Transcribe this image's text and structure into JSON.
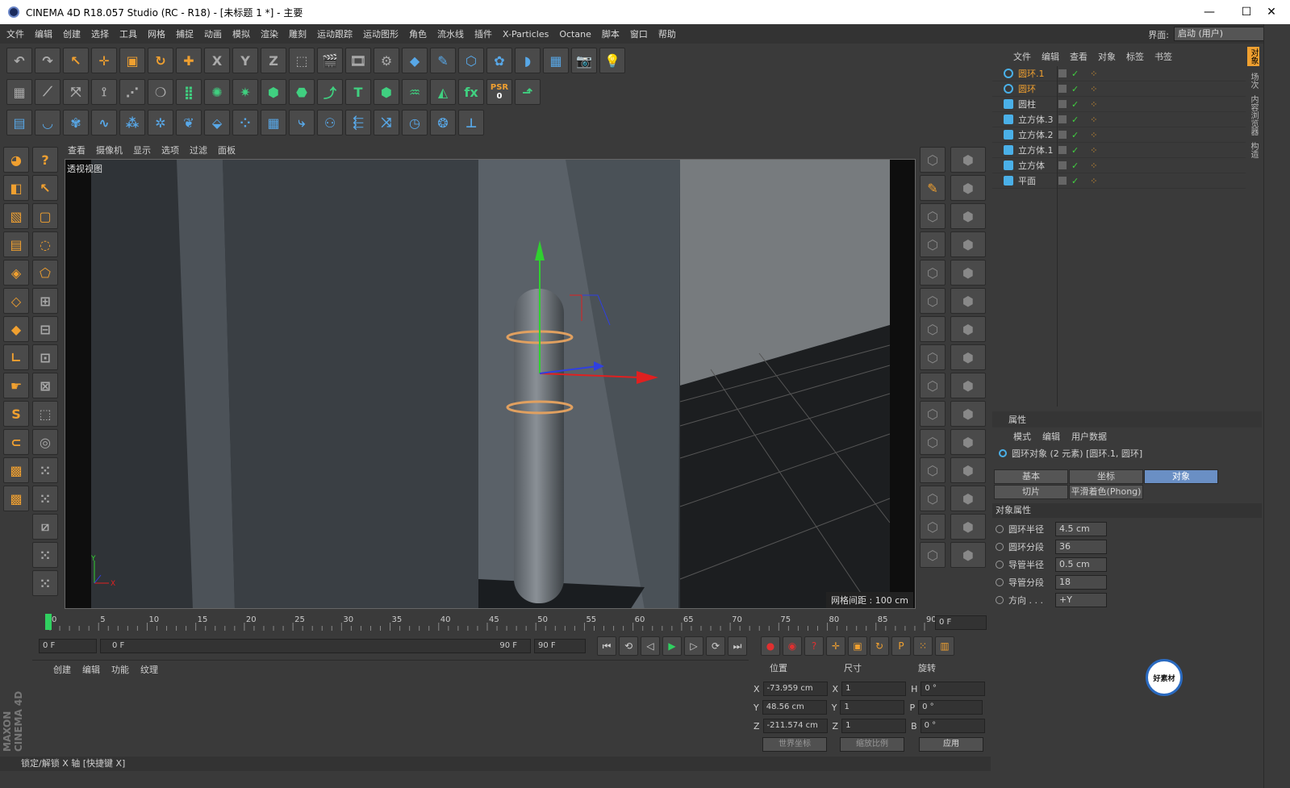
{
  "window": {
    "title": "CINEMA 4D R18.057 Studio (RC - R18) - [未标题 1 *] - 主要",
    "minimize": "—",
    "maximize": "☐",
    "close": "✕"
  },
  "menu": [
    "文件",
    "编辑",
    "创建",
    "选择",
    "工具",
    "网格",
    "捕捉",
    "动画",
    "模拟",
    "渲染",
    "雕刻",
    "运动跟踪",
    "运动图形",
    "角色",
    "流水线",
    "插件",
    "X-Particles",
    "Octane",
    "脚本",
    "窗口",
    "帮助"
  ],
  "layout": {
    "label": "界面:",
    "value": "启动 (用户)"
  },
  "toolbar_row1": [
    {
      "name": "undo-icon",
      "glyph": "↶"
    },
    {
      "name": "redo-icon",
      "glyph": "↷"
    },
    {
      "name": "select-icon",
      "glyph": "↖"
    },
    {
      "name": "move-icon",
      "glyph": "✛"
    },
    {
      "name": "scale-icon",
      "glyph": "▣"
    },
    {
      "name": "rotate-icon",
      "glyph": "↻"
    },
    {
      "name": "add-icon",
      "glyph": "✚"
    },
    {
      "name": "x-axis-icon",
      "glyph": "X"
    },
    {
      "name": "y-axis-icon",
      "glyph": "Y"
    },
    {
      "name": "z-axis-icon",
      "glyph": "Z"
    },
    {
      "name": "coord-system-icon",
      "glyph": "⬚"
    },
    {
      "name": "render-view-icon",
      "glyph": "🎬"
    },
    {
      "name": "render-picture-viewer-icon",
      "glyph": "🎞"
    },
    {
      "name": "render-settings-icon",
      "glyph": "⚙"
    },
    {
      "name": "cube-icon",
      "glyph": "◆"
    },
    {
      "name": "pen-icon",
      "glyph": "✎"
    },
    {
      "name": "subdivision-icon",
      "glyph": "⬡"
    },
    {
      "name": "cloner-icon",
      "glyph": "✿"
    },
    {
      "name": "deformer-icon",
      "glyph": "◗"
    },
    {
      "name": "floor-icon",
      "glyph": "▦"
    },
    {
      "name": "camera-icon",
      "glyph": "📷"
    },
    {
      "name": "light-icon",
      "glyph": "💡"
    }
  ],
  "toolbar_row2": [
    {
      "name": "plugin-icon-1",
      "glyph": "▦"
    },
    {
      "name": "plugin-icon-2",
      "glyph": "⟋"
    },
    {
      "name": "plugin-icon-3",
      "glyph": "⤧"
    },
    {
      "name": "plugin-icon-4",
      "glyph": "⟟"
    },
    {
      "name": "plugin-icon-5",
      "glyph": "⋰"
    },
    {
      "name": "plugin-icon-6",
      "glyph": "❍"
    },
    {
      "name": "plugin-icon-7",
      "glyph": "⣿"
    },
    {
      "name": "plugin-icon-8",
      "glyph": "✺"
    },
    {
      "name": "plugin-icon-9",
      "glyph": "✷"
    },
    {
      "name": "plugin-icon-10",
      "glyph": "⬢"
    },
    {
      "name": "plugin-icon-11",
      "glyph": "⬣"
    },
    {
      "name": "plugin-icon-12",
      "glyph": "⤴"
    },
    {
      "name": "text-icon",
      "glyph": "T"
    },
    {
      "name": "plugin-icon-13",
      "glyph": "⬢"
    },
    {
      "name": "plugin-icon-14",
      "glyph": "♒"
    },
    {
      "name": "plugin-icon-15",
      "glyph": "◭"
    },
    {
      "name": "fx-icon",
      "glyph": "fx"
    },
    {
      "name": "psr-icon",
      "glyph": "PSR"
    },
    {
      "name": "plugin-icon-16",
      "glyph": "⬏"
    }
  ],
  "psr_value": "0",
  "toolbar_row3": [
    {
      "name": "xp-icon-1",
      "glyph": "▤"
    },
    {
      "name": "xp-icon-2",
      "glyph": "◡"
    },
    {
      "name": "xp-icon-3",
      "glyph": "✾"
    },
    {
      "name": "xp-icon-4",
      "glyph": "∿"
    },
    {
      "name": "xp-icon-5",
      "glyph": "⁂"
    },
    {
      "name": "xp-icon-6",
      "glyph": "✲"
    },
    {
      "name": "xp-icon-7",
      "glyph": "❦"
    },
    {
      "name": "xp-icon-8",
      "glyph": "⬙"
    },
    {
      "name": "xp-icon-9",
      "glyph": "⁘"
    },
    {
      "name": "xp-icon-10",
      "glyph": "▦"
    },
    {
      "name": "xp-icon-11",
      "glyph": "⤷"
    },
    {
      "name": "xp-icon-12",
      "glyph": "⚇"
    },
    {
      "name": "xp-icon-13",
      "glyph": "⬱"
    },
    {
      "name": "xp-icon-14",
      "glyph": "⤨"
    },
    {
      "name": "xp-icon-15",
      "glyph": "◷"
    },
    {
      "name": "xp-icon-16",
      "glyph": "❂"
    },
    {
      "name": "xp-icon-17",
      "glyph": "⊥"
    }
  ],
  "left_col": [
    {
      "name": "model-mode-icon",
      "glyph": "◕"
    },
    {
      "name": "object-mode-icon",
      "glyph": "◧"
    },
    {
      "name": "texture-mode-icon",
      "glyph": "▧"
    },
    {
      "name": "workplane-icon",
      "glyph": "▤"
    },
    {
      "name": "point-mode-icon",
      "glyph": "◈"
    },
    {
      "name": "edge-mode-icon",
      "glyph": "◇"
    },
    {
      "name": "polygon-mode-icon",
      "glyph": "◆"
    },
    {
      "name": "axis-mode-icon",
      "glyph": "∟"
    },
    {
      "name": "tweak-mode-icon",
      "glyph": "☛"
    },
    {
      "name": "solo-icon",
      "glyph": "S"
    },
    {
      "name": "snap-icon",
      "glyph": "⊂"
    },
    {
      "name": "snap-settings-icon",
      "glyph": "▩"
    },
    {
      "name": "workplane-snap-icon",
      "glyph": "▩"
    }
  ],
  "left_col2": [
    {
      "name": "help-icon",
      "glyph": "?"
    },
    {
      "name": "live-select-icon",
      "glyph": "↖"
    },
    {
      "name": "rect-select-icon",
      "glyph": "▢"
    },
    {
      "name": "lasso-select-icon",
      "glyph": "◌"
    },
    {
      "name": "poly-select-icon",
      "glyph": "⬠"
    },
    {
      "name": "tool-icon-1",
      "glyph": "⊞"
    },
    {
      "name": "tool-icon-2",
      "glyph": "⊟"
    },
    {
      "name": "tool-icon-3",
      "glyph": "⊡"
    },
    {
      "name": "tool-icon-4",
      "glyph": "⊠"
    },
    {
      "name": "tool-icon-5",
      "glyph": "⬚"
    },
    {
      "name": "tool-icon-6",
      "glyph": "◎"
    },
    {
      "name": "tool-icon-7",
      "glyph": "⁙"
    },
    {
      "name": "tool-icon-8",
      "glyph": "⁙"
    },
    {
      "name": "tool-icon-9",
      "glyph": "⧄"
    },
    {
      "name": "tool-icon-10",
      "glyph": "⁙"
    },
    {
      "name": "tool-icon-11",
      "glyph": "⁙"
    }
  ],
  "viewport": {
    "menu": [
      "查看",
      "摄像机",
      "显示",
      "选项",
      "过滤",
      "面板"
    ],
    "label": "透视视图",
    "grid_info": "网格间距 : 100 cm",
    "axis_y": "Y",
    "axis_x": "X"
  },
  "timeline": {
    "ticks": [
      "0",
      "5",
      "10",
      "15",
      "20",
      "25",
      "30",
      "35",
      "40",
      "45",
      "50",
      "55",
      "60",
      "65",
      "70",
      "75",
      "80",
      "85",
      "90"
    ],
    "current_frame": "0 F"
  },
  "playback": {
    "start": "0 F",
    "range_start": "0 F",
    "range_end": "90 F",
    "end": "90 F",
    "icons": [
      {
        "name": "goto-start-icon",
        "glyph": "⏮"
      },
      {
        "name": "prev-key-icon",
        "glyph": "⟲"
      },
      {
        "name": "prev-frame-icon",
        "glyph": "◁"
      },
      {
        "name": "play-icon",
        "glyph": "▶"
      },
      {
        "name": "next-frame-icon",
        "glyph": "▷"
      },
      {
        "name": "next-key-icon",
        "glyph": "⟳"
      },
      {
        "name": "goto-end-icon",
        "glyph": "⏭"
      }
    ],
    "rec_icons": [
      {
        "name": "record-icon",
        "glyph": "●"
      },
      {
        "name": "autokey-icon",
        "glyph": "◉"
      },
      {
        "name": "key-help-icon",
        "glyph": "?"
      },
      {
        "name": "key-move-icon",
        "glyph": "✛"
      },
      {
        "name": "key-scale-icon",
        "glyph": "▣"
      },
      {
        "name": "key-rotate-icon",
        "glyph": "↻"
      },
      {
        "name": "key-param-icon",
        "glyph": "P"
      },
      {
        "name": "key-pla-icon",
        "glyph": "⁙"
      },
      {
        "name": "timeline-icon",
        "glyph": "▥"
      }
    ]
  },
  "material": {
    "menu": [
      "创建",
      "编辑",
      "功能",
      "纹理"
    ]
  },
  "coords": {
    "headers": [
      "位置",
      "尺寸",
      "旋转"
    ],
    "rows": [
      {
        "pl": "X",
        "pv": "-73.959 cm",
        "sl": "X",
        "sv": "1",
        "rl": "H",
        "rv": "0 °"
      },
      {
        "pl": "Y",
        "pv": "48.56 cm",
        "sl": "Y",
        "sv": "1",
        "rl": "P",
        "rv": "0 °"
      },
      {
        "pl": "Z",
        "pv": "-211.574 cm",
        "sl": "Z",
        "sv": "1",
        "rl": "B",
        "rv": "0 °"
      }
    ],
    "world": "世界坐标",
    "scale": "缩放比例",
    "apply": "应用"
  },
  "status": "锁定/解锁 X 轴 [快捷键 X]",
  "brand": "MAXON CINEMA 4D",
  "objects": {
    "menu": [
      "文件",
      "编辑",
      "查看",
      "对象",
      "标签",
      "书签"
    ],
    "items": [
      {
        "name": "圆环.1",
        "selected": true,
        "color": "#f0a030"
      },
      {
        "name": "圆环",
        "selected": true,
        "color": "#f0a030"
      },
      {
        "name": "圆柱",
        "selected": false,
        "color": "#cfcfcf"
      },
      {
        "name": "立方体.3",
        "selected": false,
        "color": "#cfcfcf"
      },
      {
        "name": "立方体.2",
        "selected": false,
        "color": "#cfcfcf"
      },
      {
        "name": "立方体.1",
        "selected": false,
        "color": "#cfcfcf"
      },
      {
        "name": "立方体",
        "selected": false,
        "color": "#cfcfcf"
      },
      {
        "name": "平面",
        "selected": false,
        "color": "#cfcfcf"
      }
    ]
  },
  "attributes": {
    "title": "属性",
    "menu": [
      "模式",
      "编辑",
      "用户数据"
    ],
    "object": "圆环对象 (2 元素) [圆环.1, 圆环]",
    "tabs": [
      "基本",
      "坐标",
      "对象",
      "切片",
      "平滑着色(Phong)"
    ],
    "section": "对象属性",
    "props": [
      {
        "label": "圆环半径",
        "value": "4.5 cm"
      },
      {
        "label": "圆环分段",
        "value": "36"
      },
      {
        "label": "导管半径",
        "value": "0.5 cm"
      },
      {
        "label": "导管分段",
        "value": "18"
      },
      {
        "label": "方向 . . .",
        "value": "+Y"
      }
    ]
  },
  "side_tabs": [
    "对象",
    "场次",
    "内容浏览器",
    "构造"
  ],
  "badge": "好素材"
}
